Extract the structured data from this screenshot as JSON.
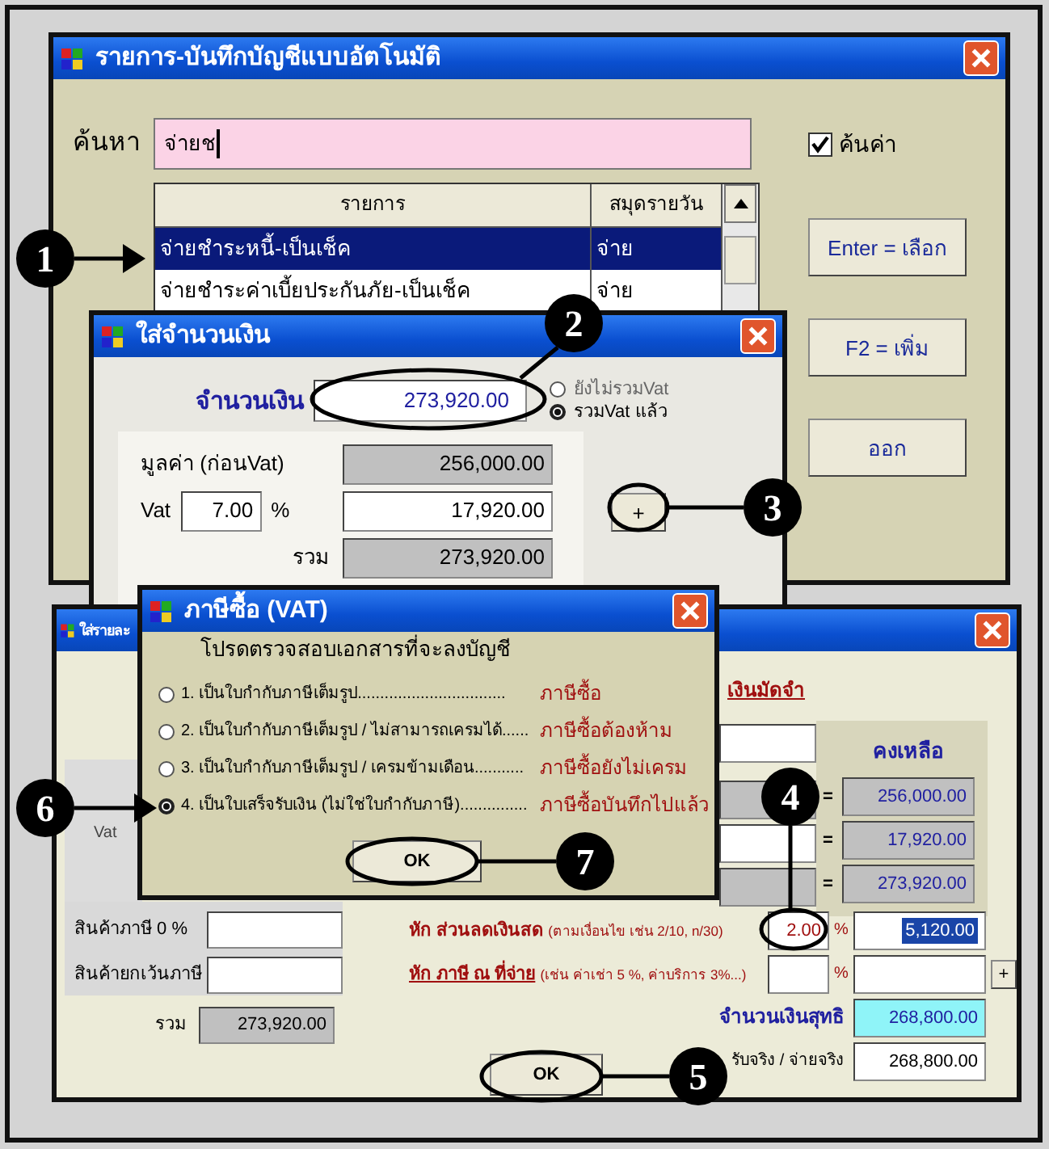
{
  "main_window": {
    "title": "รายการ-บันทึกบัญชีแบบอัตโนมัติ",
    "search": {
      "label": "ค้นหา",
      "value": "จ่ายช"
    },
    "filter_checkbox": {
      "label": "ค้นค่า",
      "checked": true
    },
    "table": {
      "columns": [
        "รายการ",
        "สมุดรายวัน"
      ],
      "rows": [
        {
          "cells": [
            "จ่ายชำระหนี้-เป็นเช็ค",
            "จ่าย"
          ],
          "selected": true
        },
        {
          "cells": [
            "จ่ายชำระค่าเบี้ยประกันภัย-เป็นเช็ค",
            "จ่าย"
          ],
          "selected": false
        }
      ]
    },
    "buttons": [
      "Enter = เลือก",
      "F2 = เพิ่ม",
      "ออก"
    ]
  },
  "amount_dialog": {
    "title": "ใส่จำนวนเงิน",
    "amount_label": "จำนวนเงิน",
    "amount": "273,920.00",
    "vat_options": [
      {
        "label": "ยังไม่รวมVat",
        "selected": false
      },
      {
        "label": "รวมVat แล้ว",
        "selected": true
      }
    ],
    "base_label": "มูลค่า (ก่อนVat)",
    "base_value": "256,000.00",
    "vat_label": "Vat",
    "vat_rate": "7.00",
    "percent": "%",
    "vat_value": "17,920.00",
    "total_label": "รวม",
    "total_value": "273,920.00",
    "add_button": "+"
  },
  "detail_window": {
    "title": "ใส่รายละ",
    "deposit_link": "เงินมัดจำ",
    "vat_label": "Vat",
    "balance_header": "คงเหลือ",
    "balance_rows": [
      {
        "sign": "=",
        "value": "256,000.00"
      },
      {
        "sign": "=",
        "value": "17,920.00"
      },
      {
        "sign": "=",
        "value": "273,920.00"
      }
    ],
    "zero_rate_label": "สินค้าภาษี 0 %",
    "exempt_label": "สินค้ายกเว้นภาษี",
    "total_label": "รวม",
    "total_value": "273,920.00",
    "discount": {
      "label": "หัก ส่วนลดเงินสด",
      "note": "(ตามเงื่อนไข เช่น 2/10, n/30)",
      "rate": "2.00",
      "percent": "%",
      "value": "5,120.00"
    },
    "withholding": {
      "label": "หัก ภาษี ณ ที่จ่าย",
      "note": "(เช่น ค่าเช่า 5 %, ค่าบริการ 3%...)",
      "percent": "%",
      "add_button": "+"
    },
    "net_label": "จำนวนเงินสุทธิ",
    "net_value": "268,800.00",
    "received_label": "รับจริง / จ่ายจริง",
    "received_value": "268,800.00",
    "ok_button": "OK"
  },
  "vat_dialog": {
    "title": "ภาษีซื้อ (VAT)",
    "prompt": "โปรดตรวจสอบเอกสารที่จะลงบัญชี",
    "options": [
      {
        "label": "1. เป็นใบกำกับภาษีเต็มรูป.................................",
        "result": "ภาษีซื้อ",
        "selected": false
      },
      {
        "label": "2. เป็นใบกำกับภาษีเต็มรูป / ไม่สามารถเครมได้......",
        "result": "ภาษีซื้อต้องห้าม",
        "selected": false
      },
      {
        "label": "3. เป็นใบกำกับภาษีเต็มรูป / เครมข้ามเดือน...........",
        "result": "ภาษีซื้อยังไม่เครม",
        "selected": false
      },
      {
        "label": "4. เป็นใบเสร็จรับเงิน (ไม่ใช่ใบกำกับภาษี)...............",
        "result": "ภาษีซื้อบันทึกไปแล้ว",
        "selected": true
      }
    ],
    "ok_button": "OK"
  },
  "callouts": [
    "1",
    "2",
    "3",
    "4",
    "5",
    "6",
    "7"
  ]
}
